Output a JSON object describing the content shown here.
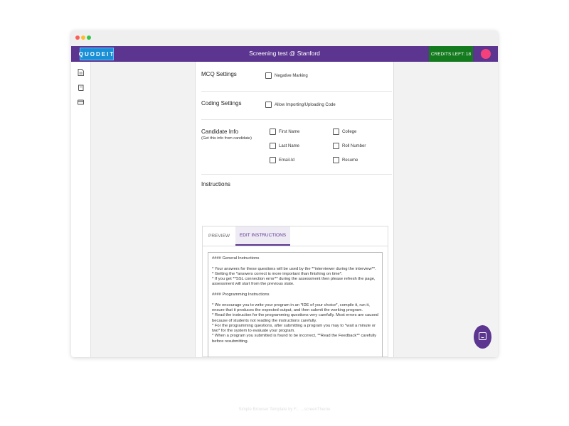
{
  "app": {
    "logo": "QUODEIT",
    "title": "Screening test @ Stanford",
    "credits": "CREDITS LEFT: 18"
  },
  "sidebar": {
    "icons": [
      "document-icon",
      "book-icon",
      "card-icon"
    ]
  },
  "mcq": {
    "label": "MCQ Settings",
    "negative_marking": "Negative Marking"
  },
  "coding": {
    "label": "Coding Settings",
    "allow_import": "Allow Importing/Uploading Code"
  },
  "candidate": {
    "label": "Candidate Info",
    "sublabel": "(Get this info from candidate)",
    "fields": [
      "First Name",
      "College",
      "Last Name",
      "Roll Number",
      "Email-Id",
      "Resume"
    ]
  },
  "instructions": {
    "label": "Instructions",
    "tab_preview": "PREVIEW",
    "tab_edit": "EDIT INSTRUCTIONS",
    "lines": [
      "#### General Instructions",
      "",
      "* Your answers for these questions will be used by the **interviewer during the interview**.",
      "* Getting the *answers correct is more important than finishing on time*.",
      "* If you get **SSL connection error** during the assessment then please refresh the page, assessment will start from the previous state.",
      "",
      "#### Programming Instructions",
      "",
      "* We encourage you to write your program in an *IDE of your choice*, compile it, run it, ensure that it produces the expected output, and then submit the working program.",
      "* Read the instruction for the programming questions very carefully. Most errors are caused because of students not reading the instructions carefully.",
      "* For the programming questions, after submitting a program you may to *wait a minute or two* for the system to evaluate your program.",
      "* When a program you submitted is found to be incorrect, **Read the Feedback** carefully before resubmitting."
    ]
  },
  "footer": "Simple Browser Template by F... ...screenTheme"
}
